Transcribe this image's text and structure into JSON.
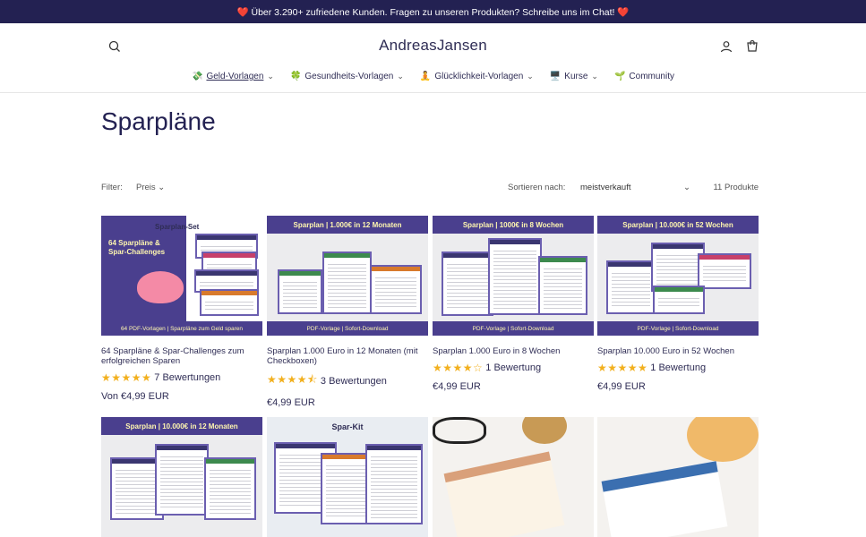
{
  "announcement": "❤️ Über 3.290+ zufriedene Kunden. Fragen zu unseren Produkten? Schreibe uns im Chat! ❤️",
  "logo": "AndreasJansen",
  "nav": [
    {
      "emoji": "💸",
      "label": "Geld-Vorlagen",
      "chevron": true,
      "active": true
    },
    {
      "emoji": "🍀",
      "label": "Gesundheits-Vorlagen",
      "chevron": true
    },
    {
      "emoji": "🧘",
      "label": "Glücklichkeit-Vorlagen",
      "chevron": true
    },
    {
      "emoji": "🖥️",
      "label": "Kurse",
      "chevron": true
    },
    {
      "emoji": "🌱",
      "label": "Community",
      "chevron": false
    }
  ],
  "page_title": "Sparpläne",
  "filter": {
    "label": "Filter:",
    "price": "Preis",
    "sort_label": "Sortieren nach:",
    "sort_value": "meistverkauft",
    "count": "11 Produkte"
  },
  "products": [
    {
      "title": "64 Sparpläne & Spar-Challenges zum erfolgreichen Sparen",
      "stars": "★★★★★",
      "reviews": "7 Bewertungen",
      "price": "Von €4,99 EUR",
      "banner": "Sparplan-Set",
      "footer": "64 PDF-Vorlagen | Sparpläne zum Geld sparen"
    },
    {
      "title": "Sparplan 1.000 Euro in 12 Monaten (mit Checkboxen)",
      "stars": "★★★★⯪",
      "reviews": "3 Bewertungen",
      "price": "€4,99 EUR",
      "banner": "Sparplan | 1.000€ in 12 Monaten",
      "footer": "PDF-Vorlage | Sofort-Download"
    },
    {
      "title": "Sparplan 1.000 Euro in 8 Wochen",
      "stars": "★★★★☆",
      "reviews": "1 Bewertung",
      "price": "€4,99 EUR",
      "banner": "Sparplan | 1000€ in 8 Wochen",
      "footer": "PDF-Vorlage | Sofort-Download"
    },
    {
      "title": "Sparplan 10.000 Euro in 52 Wochen",
      "stars": "★★★★★",
      "reviews": "1 Bewertung",
      "price": "€4,99 EUR",
      "banner": "Sparplan | 10.000€ in 52 Wochen",
      "footer": "PDF-Vorlage | Sofort-Download"
    },
    {
      "banner": "Sparplan | 10.000€ in 12 Monaten"
    },
    {
      "banner": "Spar-Kit"
    },
    {
      "banner": ""
    },
    {
      "banner": ""
    }
  ]
}
